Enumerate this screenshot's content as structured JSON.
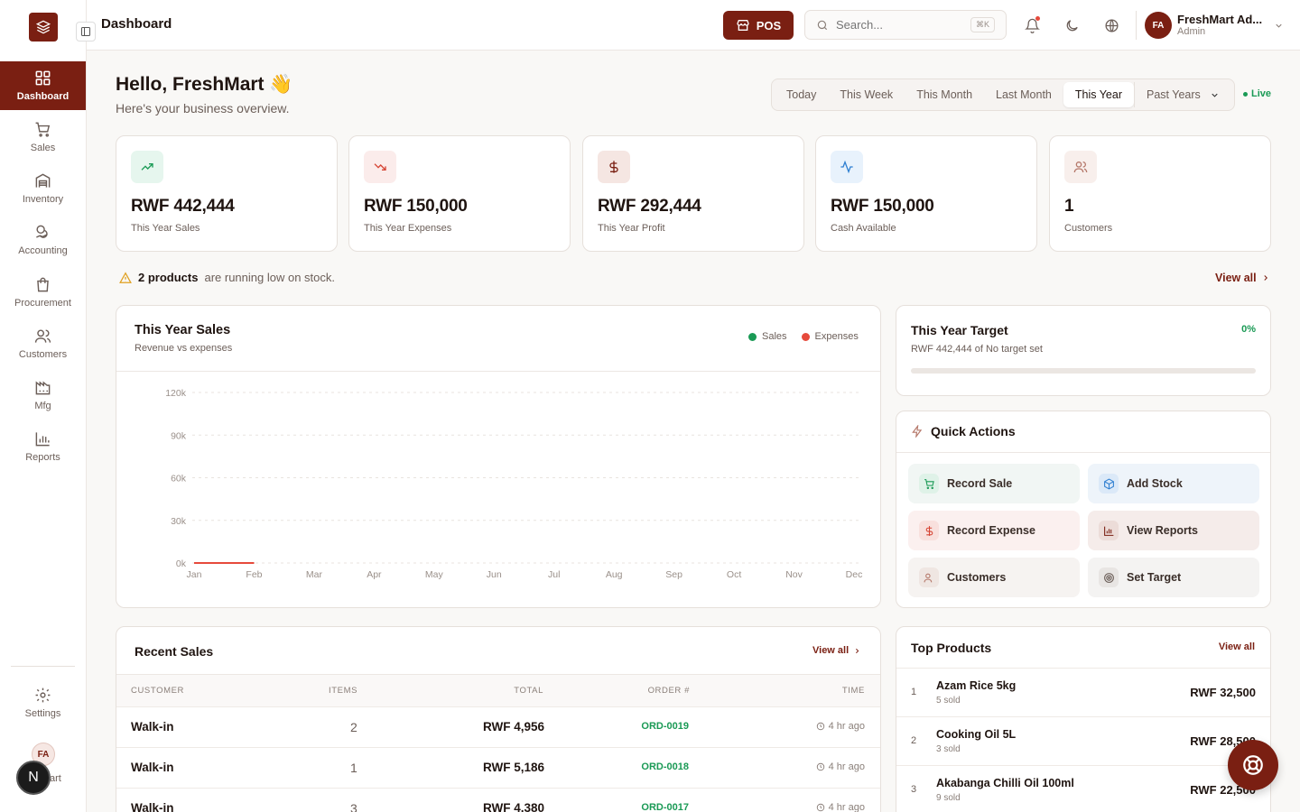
{
  "app": {
    "page_title": "Dashboard"
  },
  "sidebar": {
    "items": [
      {
        "label": "Dashboard",
        "icon": "grid-icon"
      },
      {
        "label": "Sales",
        "icon": "cart-icon"
      },
      {
        "label": "Inventory",
        "icon": "warehouse-icon"
      },
      {
        "label": "Accounting",
        "icon": "coins-icon"
      },
      {
        "label": "Procurement",
        "icon": "shopping-bag-icon"
      },
      {
        "label": "Customers",
        "icon": "users-icon"
      },
      {
        "label": "Mfg",
        "icon": "factory-icon"
      },
      {
        "label": "Reports",
        "icon": "bar-chart-icon"
      }
    ],
    "settings_label": "Settings",
    "user_initials": "FA",
    "user_short": "art",
    "dev_badge": "N"
  },
  "topbar": {
    "pos_label": "POS",
    "search_placeholder": "Search...",
    "search_shortcut": "⌘K",
    "user_initials": "FA",
    "user_name": "FreshMart Ad...",
    "user_role": "Admin"
  },
  "header": {
    "greeting": "Hello, FreshMart 👋",
    "subtitle": "Here's your business overview.",
    "periods": [
      "Today",
      "This Week",
      "This Month",
      "Last Month",
      "This Year"
    ],
    "active_period": "This Year",
    "past_years_label": "Past Years",
    "live_label": "Live"
  },
  "kpis": [
    {
      "value": "RWF 442,444",
      "label": "This Year Sales",
      "icon": "trending-up-icon",
      "color": "#1a9a55",
      "bg": "#e6f6ee"
    },
    {
      "value": "RWF 150,000",
      "label": "This Year Expenses",
      "icon": "trending-down-icon",
      "color": "#d64535",
      "bg": "#fbeceb"
    },
    {
      "value": "RWF 292,444",
      "label": "This Year Profit",
      "icon": "dollar-icon",
      "color": "#7a1f12",
      "bg": "#f5e6e2"
    },
    {
      "value": "RWF 150,000",
      "label": "Cash Available",
      "icon": "activity-icon",
      "color": "#2f7fd1",
      "bg": "#e8f2fc"
    },
    {
      "value": "1",
      "label": "Customers",
      "icon": "users-icon",
      "color": "#b5786a",
      "bg": "#f8efec"
    }
  ],
  "alert": {
    "count_text": "2 products",
    "rest_text": "are running low on stock.",
    "link": "View all"
  },
  "sales_chart": {
    "title": "This Year Sales",
    "subtitle": "Revenue vs expenses"
  },
  "chart_data": {
    "type": "line",
    "x": [
      "Jan",
      "Feb",
      "Mar",
      "Apr",
      "May",
      "Jun",
      "Jul",
      "Aug",
      "Sep",
      "Oct",
      "Nov",
      "Dec"
    ],
    "y_ticks": [
      "120k",
      "90k",
      "60k",
      "30k",
      "0k"
    ],
    "ylim": [
      0,
      120000
    ],
    "grid": true,
    "legend_position": "top-right",
    "series": [
      {
        "name": "Sales",
        "color": "#1a9a55",
        "values": [
          0,
          0,
          null,
          null,
          null,
          null,
          null,
          null,
          null,
          null,
          null,
          null
        ]
      },
      {
        "name": "Expenses",
        "color": "#e64a3c",
        "values": [
          0,
          0,
          null,
          null,
          null,
          null,
          null,
          null,
          null,
          null,
          null,
          null
        ]
      }
    ]
  },
  "target": {
    "title": "This Year Target",
    "percent": "0%",
    "subtitle": "RWF 442,444 of No target set",
    "progress": 0
  },
  "quick_actions": {
    "title": "Quick Actions",
    "items": [
      {
        "label": "Record Sale",
        "icon": "cart-icon",
        "color": "#1a9a55",
        "bg": "#f1f6f4",
        "icon_bg": "#dff2e8"
      },
      {
        "label": "Add Stock",
        "icon": "box-icon",
        "color": "#2f7fd1",
        "bg": "#eef4fa",
        "icon_bg": "#dbe9f8"
      },
      {
        "label": "Record Expense",
        "icon": "dollar-icon",
        "color": "#d64535",
        "bg": "#fbf0ef",
        "icon_bg": "#f8e0dd"
      },
      {
        "label": "View Reports",
        "icon": "bar-chart-icon",
        "color": "#7a1f12",
        "bg": "#f5ecea",
        "icon_bg": "#ecdcd8"
      },
      {
        "label": "Customers",
        "icon": "users-icon",
        "color": "#b5786a",
        "bg": "#f6f3f1",
        "icon_bg": "#efe6e2"
      },
      {
        "label": "Set Target",
        "icon": "target-icon",
        "color": "#6b5e58",
        "bg": "#f4f3f2",
        "icon_bg": "#e8e5e3"
      }
    ]
  },
  "recent_sales": {
    "title": "Recent Sales",
    "link": "View all",
    "columns": [
      "CUSTOMER",
      "ITEMS",
      "TOTAL",
      "ORDER #",
      "TIME"
    ],
    "rows": [
      {
        "customer": "Walk-in",
        "items": "2",
        "total": "RWF 4,956",
        "order": "ORD-0019",
        "time": "4 hr ago"
      },
      {
        "customer": "Walk-in",
        "items": "1",
        "total": "RWF 5,186",
        "order": "ORD-0018",
        "time": "4 hr ago"
      },
      {
        "customer": "Walk-in",
        "items": "3",
        "total": "RWF 4,380",
        "order": "ORD-0017",
        "time": "4 hr ago"
      }
    ]
  },
  "top_products": {
    "title": "Top Products",
    "link": "View all",
    "items": [
      {
        "rank": "1",
        "name": "Azam Rice 5kg",
        "sold": "5 sold",
        "amount": "RWF 32,500"
      },
      {
        "rank": "2",
        "name": "Cooking Oil 5L",
        "sold": "3 sold",
        "amount": "RWF 28,500"
      },
      {
        "rank": "3",
        "name": "Akabanga Chilli Oil 100ml",
        "sold": "9 sold",
        "amount": "RWF 22,500"
      }
    ]
  }
}
